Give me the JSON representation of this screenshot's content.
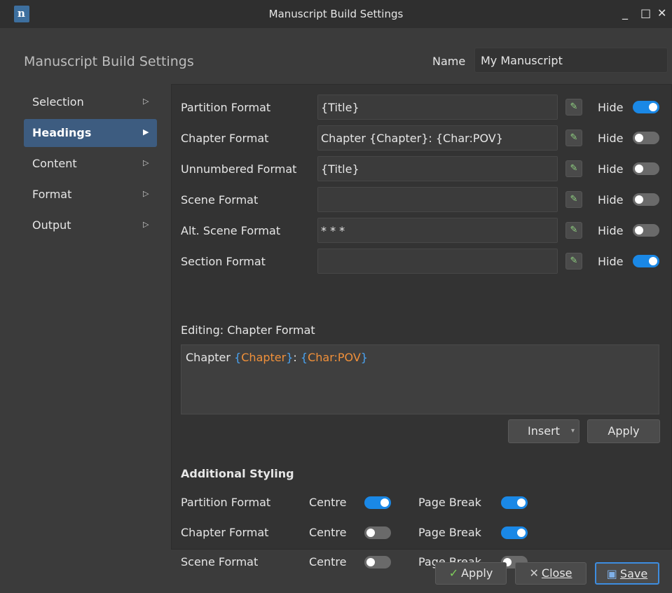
{
  "window": {
    "title": "Manuscript Build Settings",
    "app_icon_letter": "n",
    "minimize": "_",
    "maximize": "□",
    "close": "✕"
  },
  "header": {
    "title": "Manuscript Build Settings",
    "name_label": "Name",
    "name_value": "My Manuscript"
  },
  "sidebar": {
    "items": [
      {
        "label": "Selection",
        "active": false
      },
      {
        "label": "Headings",
        "active": true
      },
      {
        "label": "Content",
        "active": false
      },
      {
        "label": "Format",
        "active": false
      },
      {
        "label": "Output",
        "active": false
      }
    ]
  },
  "headings": {
    "hide_label": "Hide",
    "rows": [
      {
        "label": "Partition Format",
        "value": "{Title}",
        "hide": true
      },
      {
        "label": "Chapter Format",
        "value": "Chapter {Chapter}: {Char:POV}",
        "hide": false
      },
      {
        "label": "Unnumbered Format",
        "value": "{Title}",
        "hide": false
      },
      {
        "label": "Scene Format",
        "value": "",
        "hide": false
      },
      {
        "label": "Alt. Scene Format",
        "value": "* * *",
        "hide": false
      },
      {
        "label": "Section Format",
        "value": "",
        "hide": true
      }
    ]
  },
  "editor": {
    "label": "Editing: Chapter Format",
    "tokens": [
      {
        "text": "Chapter ",
        "kind": "plain"
      },
      {
        "text": "{",
        "kind": "brace"
      },
      {
        "text": "Chapter",
        "kind": "key"
      },
      {
        "text": "}",
        "kind": "brace"
      },
      {
        "text": ": ",
        "kind": "plain"
      },
      {
        "text": "{",
        "kind": "brace"
      },
      {
        "text": "Char:POV",
        "kind": "key"
      },
      {
        "text": "}",
        "kind": "brace"
      }
    ],
    "insert_label": "Insert",
    "apply_label": "Apply"
  },
  "styling": {
    "title": "Additional Styling",
    "centre_label": "Centre",
    "page_break_label": "Page Break",
    "rows": [
      {
        "label": "Partition Format",
        "centre": true,
        "page_break": true
      },
      {
        "label": "Chapter Format",
        "centre": false,
        "page_break": true
      },
      {
        "label": "Scene Format",
        "centre": false,
        "page_break": false
      }
    ]
  },
  "footer": {
    "apply_label": "Apply",
    "close_label": "Close",
    "save_label": "Save"
  },
  "colors": {
    "accent": "#1a88e6",
    "sidebar_active": "#3d5c80",
    "token_brace": "#4aa3f0",
    "token_key": "#f0903a"
  }
}
